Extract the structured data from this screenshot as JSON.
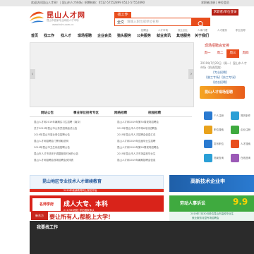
{
  "topbar": {
    "text": "欢迎访问昆山人才网！ | 昆山市人才市场  | 招聘热线：0512-57552899 0512-57552890",
    "right": "求职者注册 | 单位会员"
  },
  "logo": {
    "title": "昆山人才网",
    "subtitle": "昆山市首家专业网络人才市场",
    "url": "www.kshr.com.cn"
  },
  "search": {
    "tab_label": "找工作",
    "category": "全文",
    "placeholder": "请输入职位或单位名称",
    "button_label": "搜索"
  },
  "login_label": "求职者/单位登录",
  "nav": {
    "top_items": [
      "招聘会",
      "人才市场",
      "就业创业",
      "人事代理",
      "人才服务",
      "职业指导"
    ],
    "items": [
      "首页",
      "找工作",
      "找人才",
      "现场招聘",
      "企业会员",
      "猎头服务",
      "公共服务",
      "就业资讯",
      "其他服务",
      "关于我们"
    ]
  },
  "banner_arrows": {
    "left": "‹",
    "right": "›"
  },
  "right_panel": {
    "title": "现场招聘会安排",
    "calendar": [
      "周一",
      "周二",
      "周三",
      "周四"
    ],
    "calendar_highlight": 2,
    "lines": [
      "2019年7月29日（周一）昆山市人才",
      "市场（前进西路）",
      "【专业招聘】",
      "【普工专场】【技工专场】",
      "【综合招聘】"
    ],
    "job_banner": "昆山人才现场招聘"
  },
  "tabs": [
    "网站公告",
    "事业单位招考专区",
    "网络招聘",
    "校园招聘"
  ],
  "left_list": [
    "昆山人才网2019年暑期实习生招聘（南京）",
    "关于2019年昆山市公务员招录面试公告",
    "2019年昆山市事业单位招聘公告",
    "昆山人才网招聘会门票领取说明",
    "2019年昆山市卫生系统招聘公告",
    "昆山市人才市场关于调整服务时间的公告",
    "昆山人才网招聘会现场招聘会安排表"
  ],
  "right_list": [
    "昆山人才网2019年第30周现场招聘会",
    "2019年昆山市人才市场6月份招聘会",
    "2019年昆山市人才招聘会信息汇总",
    "昆山人才网2019年应届毕业生招聘",
    "昆山人才网2019年第28周现场招聘会",
    "2019年昆山市人才市场高校毕业生",
    "昆山人才网2019年暑期招聘会信息"
  ],
  "icons": [
    {
      "name": "个人注册",
      "color": "#2a7ad0"
    },
    {
      "name": "简历制作",
      "color": "#2a9fd6"
    },
    {
      "name": "职位搜索",
      "color": "#e8a21c"
    },
    {
      "name": "企业注册",
      "color": "#3faa3f"
    },
    {
      "name": "发布职位",
      "color": "#2a7ad0"
    },
    {
      "name": "人才搜索",
      "color": "#e84d1c"
    },
    {
      "name": "档案查询",
      "color": "#2a9fd6"
    },
    {
      "name": "在线咨询",
      "color": "#9b59b6"
    }
  ],
  "ads": {
    "ad1_title": "昆山地区专业技术人才继续教育",
    "ad1_sub": "2019年继续教育网上报名开始",
    "ad2_title": "高新技术企业申",
    "ad3_logo": "名师学府",
    "ad3_title": "成人大专、本科",
    "ad3_sub": "211/985院校 学历国家承认",
    "ad4_title": "劳动人事诉讼",
    "ad4_num": "9.9",
    "ad5_logo": "新东方",
    "ad5_title": "要让所有人,都能上大学!",
    "ad6_line1": "2019年7月30日单位昆山市高校毕业生",
    "ad6_line2": "就业服务月暨专场招聘会"
  },
  "findjob": {
    "title": "我要找工作"
  }
}
